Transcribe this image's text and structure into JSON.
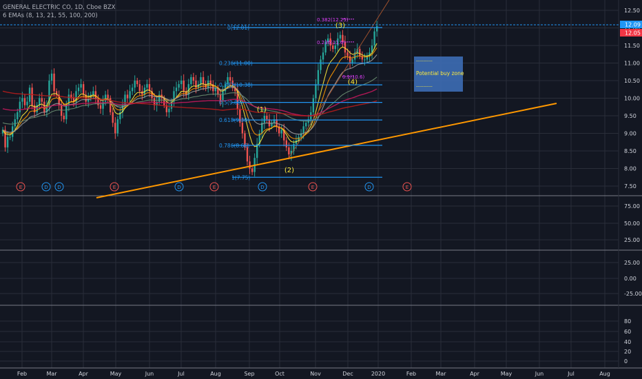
{
  "header": {
    "symbol": "GENERAL ELECTRIC CO, 1D, Cboe BZX",
    "indicator": "6 EMAs (8, 13, 21, 55, 100, 200)"
  },
  "colors": {
    "background": "#131722",
    "grid": "#2a2e39",
    "axis_text": "#d1d4dc",
    "up": "#26a69a",
    "down": "#ef5350",
    "fib": "#2196f3",
    "trendline": "#ff9800",
    "wave_label": "#ffeb3b",
    "price_marker": "#2196f3",
    "price_marker_red": "#f23645",
    "zone_fill": "#3d6db5",
    "zone_text": "#ffeb3b",
    "ext_label": "#e040fb"
  },
  "chart_data": {
    "type": "candlestick",
    "x_ticks": [
      "Feb",
      "Mar",
      "Apr",
      "May",
      "Jun",
      "Jul",
      "Aug",
      "Sep",
      "Oct",
      "Nov",
      "Dec",
      "2020",
      "Feb",
      "Mar",
      "Apr",
      "May",
      "Jun",
      "Jul",
      "Aug"
    ],
    "price_axis": {
      "ticks": [
        "12.50",
        "12.00",
        "11.50",
        "11.00",
        "10.50",
        "10.00",
        "9.50",
        "9.00",
        "8.50",
        "8.00",
        "7.50"
      ],
      "ylim": [
        7.3,
        12.7
      ]
    },
    "price_tags": [
      "12.09",
      "12.05"
    ],
    "panel_axes": [
      {
        "ticks": [
          "75.00",
          "50.00",
          "25.00"
        ]
      },
      {
        "ticks": [
          "25.00",
          "0.00",
          "-25.00"
        ]
      },
      {
        "ticks": [
          "80",
          "60",
          "40",
          "20",
          "0"
        ]
      }
    ],
    "ohlc_path": [
      9.1,
      8.6,
      8.9,
      8.9,
      9.2,
      9.4,
      9.6,
      9.9,
      10.0,
      9.8,
      9.9,
      10.3,
      9.8,
      9.6,
      9.8,
      10.0,
      9.9,
      9.6,
      9.8,
      10.5,
      10.7,
      10.2,
      10.1,
      9.8,
      9.5,
      9.4,
      9.8,
      10.1,
      10.0,
      9.9,
      10.2,
      10.3,
      10.4,
      10.1,
      9.9,
      10.0,
      10.1,
      10.2,
      10.0,
      9.8,
      9.7,
      9.9,
      10.1,
      10.0,
      9.6,
      9.3,
      9.0,
      9.4,
      9.6,
      9.8,
      10.1,
      10.0,
      10.2,
      10.3,
      10.5,
      10.4,
      10.2,
      10.1,
      10.3,
      10.4,
      10.2,
      10.0,
      9.8,
      9.9,
      10.1,
      10.0,
      9.8,
      9.6,
      9.7,
      9.9,
      10.2,
      10.3,
      10.4,
      10.5,
      10.2,
      10.1,
      10.4,
      10.6,
      10.5,
      10.3,
      10.4,
      10.6,
      10.4,
      10.3,
      10.5,
      10.4,
      10.2,
      10.3,
      10.1,
      9.9,
      10.2,
      10.4,
      10.6,
      10.5,
      10.3,
      10.2,
      9.7,
      9.3,
      9.0,
      8.6,
      8.2,
      8.0,
      7.9,
      8.3,
      8.7,
      9.0,
      9.3,
      9.5,
      9.4,
      9.2,
      9.3,
      9.4,
      9.2,
      9.0,
      9.1,
      8.8,
      8.6,
      8.4,
      8.5,
      8.7,
      8.8,
      8.9,
      9.0,
      9.2,
      9.3,
      9.4,
      9.6,
      10.0,
      10.4,
      10.8,
      11.1,
      11.3,
      11.6,
      11.7,
      11.5,
      11.4,
      11.5,
      11.7,
      11.8,
      11.6,
      11.3,
      11.2,
      11.0,
      11.1,
      11.3,
      11.4,
      11.2,
      11.1,
      11.1,
      11.2,
      11.3,
      11.5,
      11.9,
      12.05
    ],
    "emas": [
      {
        "period": 8,
        "color": "#ffeb3b"
      },
      {
        "period": 13,
        "color": "#ff9800"
      },
      {
        "period": 21,
        "color": "#9e9e9e"
      },
      {
        "period": 55,
        "color": "#6b8f71"
      },
      {
        "period": 100,
        "color": "#c2185b"
      },
      {
        "period": 200,
        "color": "#b71c1c"
      }
    ],
    "fib_levels": [
      {
        "label": "0(12.01)",
        "price": 12.01
      },
      {
        "label": "0.236(11.00)",
        "price": 11.0
      },
      {
        "label": "0.382(10.38)",
        "price": 10.38
      },
      {
        "label": "0.5(9.88)",
        "price": 9.88
      },
      {
        "label": "0.618(9.38)",
        "price": 9.38
      },
      {
        "label": "0.786(8.66)",
        "price": 8.66
      },
      {
        "label": "1(7.75)",
        "price": 7.75
      }
    ],
    "fib_ext_levels": [
      {
        "label": "0.382(12.25)",
        "price": 12.25
      },
      {
        "label": "0.236(11.6)",
        "price": 11.6
      },
      {
        "label": "0.1(10.6)",
        "price": 10.62
      }
    ],
    "wave_labels": [
      "(1)",
      "(2)",
      "(3)",
      "(4)"
    ],
    "events": [
      "E",
      "D",
      "D",
      "E",
      "D",
      "E",
      "D",
      "E",
      "D",
      "E"
    ],
    "annotation": {
      "text": "Potential buy zone",
      "dashes": "-----------"
    }
  }
}
